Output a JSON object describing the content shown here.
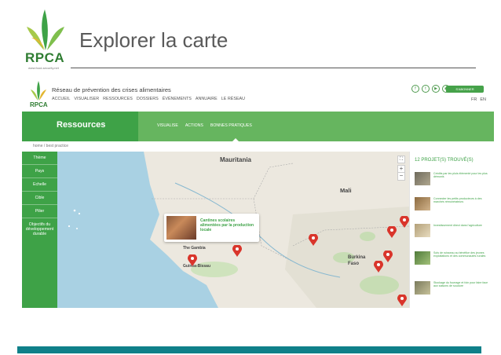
{
  "slide": {
    "logo_text": "RPCA",
    "logo_small": "www.food-security.net",
    "title": "Explorer la carte"
  },
  "site": {
    "logo_text": "RPCA",
    "name": "Réseau de prévention des crises alimentaires",
    "nav": [
      "ACCUEIL",
      "VISUALISER",
      "RESSOURCES",
      "DOSSIERS",
      "ÉVÉNEMENTS",
      "ANNUAIRE",
      "LE RÉSEAU"
    ],
    "social_icons": [
      "facebook-icon",
      "twitter-icon",
      "youtube-icon",
      "rss-icon"
    ],
    "subscribe_label": "S'ABONNER",
    "languages": [
      "FR",
      "EN"
    ],
    "section_title": "Ressources",
    "tabs": [
      "VISUALISE",
      "ACTIONS",
      "BONNES PRATIQUES"
    ],
    "breadcrumb": "home / best practice",
    "filters": [
      "Thème",
      "Pays",
      "Echelle",
      "Cible",
      "Pilier",
      "Objectifs du développement durable"
    ],
    "map_labels": [
      "Mauritania",
      "Mali",
      "Burkina Faso",
      "Guinea-Bissau",
      "The Gambia"
    ],
    "popup_text": "Cantines scolaires alimentées par la production locale",
    "results_title": "12 PROJET(S) TROUVÉ(S)",
    "results": [
      "Crédits par les pluis élémenté pour les plus démunis",
      "Connecter les petits producteurs à des marchés rémunérateurs",
      "Investissement direct dans l'agriculture",
      "Sols de ruisseau au bénéfice des jeunes exploitations et des communautés rurales",
      "Stockage du fourrage et foin pour faire face aux saisons de soudure"
    ]
  },
  "colors": {
    "brand_green": "#3ea247",
    "bar_green": "#66b55f",
    "bottom_bar": "#0f8089",
    "marker": "#d9352b"
  }
}
